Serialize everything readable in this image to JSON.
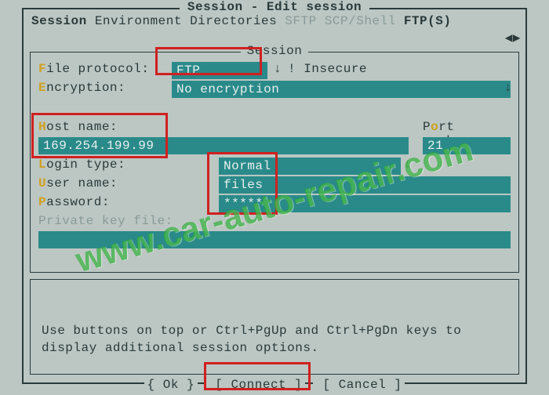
{
  "window": {
    "title": "Session - Edit session"
  },
  "tabs": {
    "session": "Session",
    "environment": "Environment",
    "directories": "Directories",
    "sftp": "SFTP",
    "scpshell": "SCP/Shell",
    "ftps": "FTP(S)"
  },
  "session_box_label": "Session",
  "fields": {
    "file_protocol_label": "ile protocol:",
    "file_protocol_value": "FTP",
    "insecure_note": "! Insecure",
    "encryption_label": "ncryption:",
    "encryption_value": "No encryption",
    "host_label": "ost name:",
    "host_value": "169.254.199.99",
    "port_label": "Port number:",
    "port_value": "21",
    "login_type_label": "ogin type:",
    "login_type_value": "Normal",
    "user_label": "ser name:",
    "user_value": "files",
    "password_label": "assword:",
    "password_value": "*****",
    "private_key_label": "Private key file:"
  },
  "hint": "Use buttons on top or Ctrl+PgUp and Ctrl+PgDn keys to display additional session options.",
  "buttons": {
    "ok": "{ Ok }",
    "connect": "[ Connect ]",
    "cancel": "[ Cancel ]"
  },
  "arrows": "◀▶",
  "drop_arrow": "↓",
  "watermark": "www.car-auto-repair.com"
}
